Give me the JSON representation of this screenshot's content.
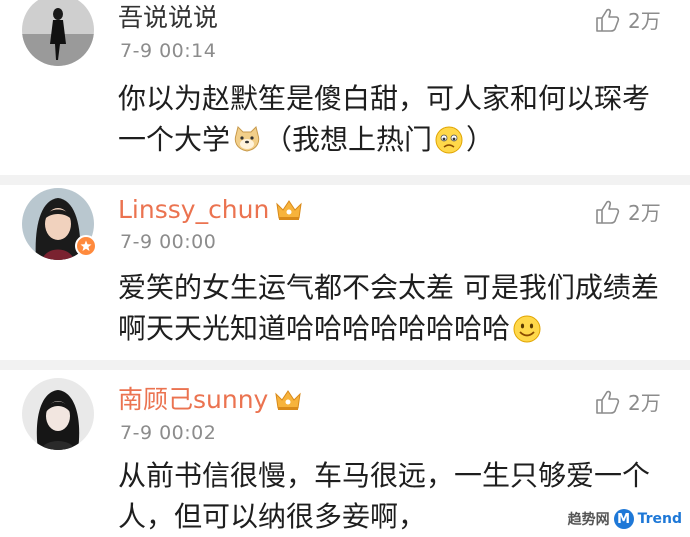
{
  "comments": [
    {
      "username": "吾说说说",
      "time": "7-9 00:14",
      "likes": "2万",
      "lines": [
        {
          "text": "你以为赵默笙是傻白甜，可人家和何以琛考"
        },
        {
          "text_before": "一个大学",
          "emoji1": "doge-emoji",
          "text_mid": "（我想上热门",
          "emoji2": "sad-emoji",
          "text_after": "）"
        }
      ]
    },
    {
      "username": "Linssy_chun",
      "time": "7-9 00:00",
      "likes": "2万",
      "lines": [
        {
          "text": "爱笑的女生运气都不会太差 可是我们成绩差"
        },
        {
          "text_before": "啊天天光知道哈哈哈哈哈哈哈哈",
          "emoji1": "smile-emoji"
        }
      ]
    },
    {
      "username": "南顾己sunny",
      "time": "7-9 00:02",
      "likes": "2万",
      "lines": [
        {
          "text": "从前书信很慢，车马很远，一生只够爱一个"
        },
        {
          "text": "人，但可以纳很多妾啊，"
        }
      ]
    }
  ],
  "watermark": {
    "cn": "趋势网",
    "logo": "M",
    "en": "Trend"
  },
  "colors": {
    "vip_name": "#eb7350",
    "meta": "#8c8c8c",
    "text": "#1e1e1e"
  }
}
